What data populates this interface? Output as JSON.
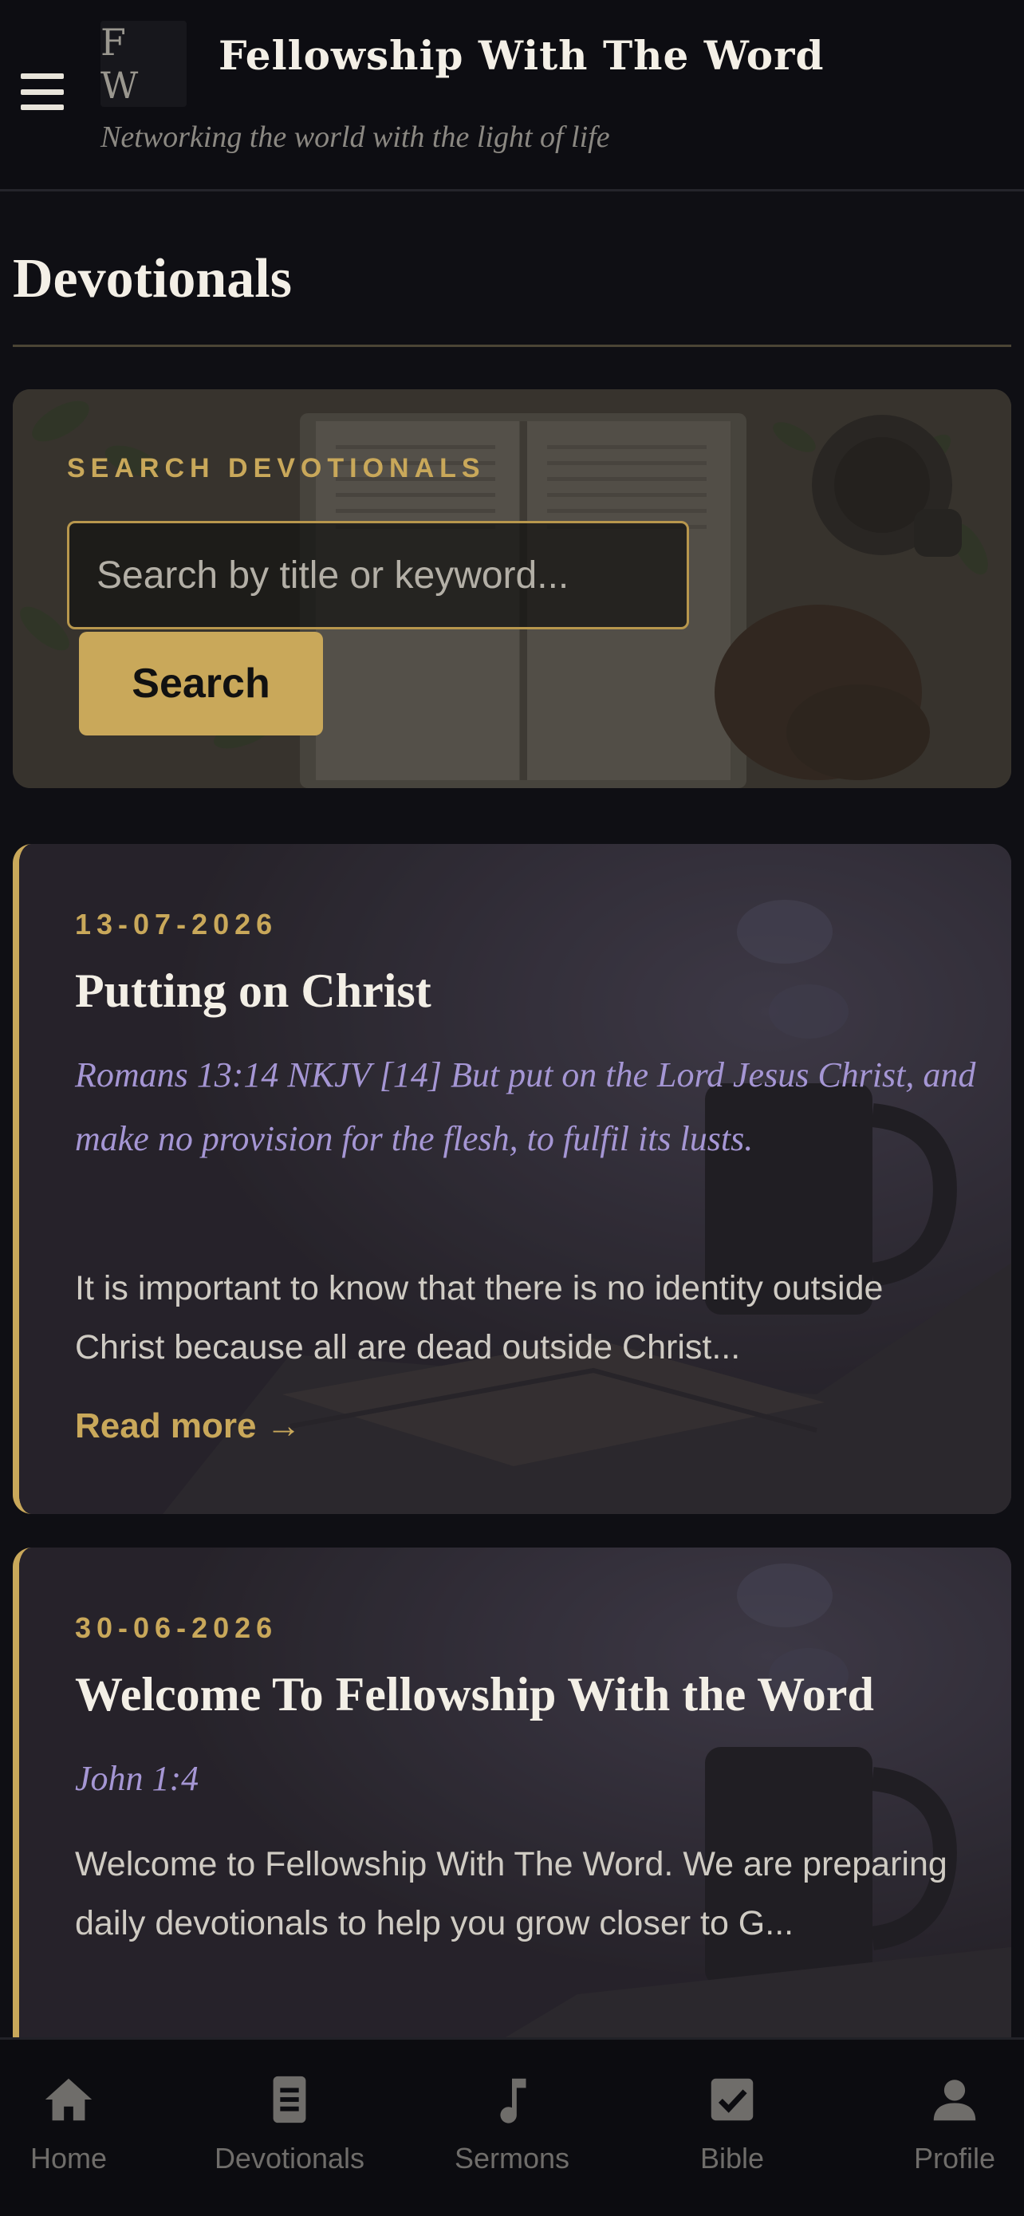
{
  "header": {
    "logo_text": "F W",
    "title": "Fellowship With The Word",
    "tagline": "Networking the world with the light of life"
  },
  "page": {
    "title": "Devotionals"
  },
  "search": {
    "label": "SEARCH DEVOTIONALS",
    "placeholder": "Search by title or keyword...",
    "button_label": "Search"
  },
  "devotionals": [
    {
      "date": "13-07-2026",
      "title": "Putting on Christ",
      "verse": "Romans 13:14 NKJV [14] But put on the Lord Jesus Christ, and make no provision for the flesh, to fulfil its lusts.",
      "excerpt": "It is important to know that there is no identity outside Christ because all are dead outside Christ...",
      "read_more": "Read more →"
    },
    {
      "date": "30-06-2026",
      "title": "Welcome To Fellowship With the Word",
      "verse": "John 1:4",
      "excerpt": "Welcome to Fellowship With The Word. We are preparing daily devotionals to help you grow closer to G..."
    }
  ],
  "bottom_nav": [
    {
      "label": "Home",
      "icon": "home-icon"
    },
    {
      "label": "Devotionals",
      "icon": "book-icon"
    },
    {
      "label": "Sermons",
      "icon": "music-note-icon"
    },
    {
      "label": "Bible",
      "icon": "checkbox-icon"
    },
    {
      "label": "Profile",
      "icon": "person-icon"
    }
  ],
  "colors": {
    "accent_gold": "#c9a85a",
    "verse_lavender": "#a596d4",
    "background": "#0f0f14",
    "nav_inactive": "#6f6d6a"
  }
}
